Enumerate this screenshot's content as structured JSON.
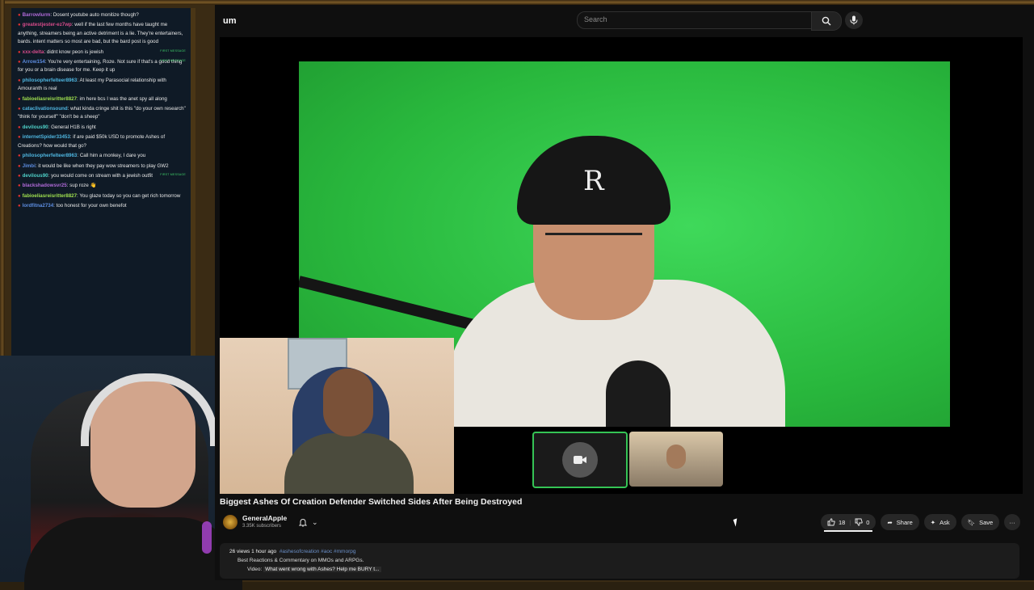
{
  "chat": [
    {
      "user": "Barrowlurm",
      "color": "#b06ad8",
      "text": "Dosent youtube auto monitize though?",
      "first": false
    },
    {
      "user": "greatestjester-ez7wp",
      "color": "#d64b8a",
      "text": "well if the last few months have taught me anything, streamers being an active detriment is a lie. They're entertainers, bards. intent matters so most are bad, but the bard post is good",
      "first": false
    },
    {
      "user": "xxx-delta",
      "color": "#d64b8a",
      "text": "didnt know peon is jewish",
      "first": true
    },
    {
      "user": "Arrow154",
      "color": "#5d8de0",
      "text": "You're very entertaining, Roze. Not sure if that's a good thing for you or a brain disease for me. Keep it up",
      "first": true
    },
    {
      "user": "philosopherfelteer8963",
      "color": "#4fb6e0",
      "text": "At least my Parasocial relationship with Amouranth is real",
      "first": false
    },
    {
      "user": "fabioeliasreisritter8827",
      "color": "#9fe04f",
      "text": "im here bcs I was the anet spy all along",
      "first": false
    },
    {
      "user": "cataclivationsound",
      "color": "#4fb6e0",
      "text": "what kinda cringe shit is this \"do your own research\" \"think for yourself\" \"don't be a sheep\"",
      "first": false
    },
    {
      "user": "devilous90",
      "color": "#4fd0c8",
      "text": "General H1B is right",
      "first": false
    },
    {
      "user": "internetSpider33453",
      "color": "#4fb6e0",
      "text": "if are paid $50k USD to promote Ashes of Creations? how would that go?",
      "first": false
    },
    {
      "user": "philosopherfelteer8963",
      "color": "#4fb6e0",
      "text": "Call him a monkey, I dare you",
      "first": false
    },
    {
      "user": "Jimbi",
      "color": "#5d8de0",
      "text": "it would be like when they pay wow streamers to play GW2",
      "first": false
    },
    {
      "user": "devilous90",
      "color": "#4fd0c8",
      "text": "you would come on stream with a jewish outfit",
      "first": true
    },
    {
      "user": "blackshadowsvr25",
      "color": "#b06ad8",
      "text": "sup roze 👋",
      "first": false
    },
    {
      "user": "fabioeliasreisritter8827",
      "color": "#9fe04f",
      "text": "You glaze today so you can get rich tomorrow",
      "first": false
    },
    {
      "user": "lordfitna2734",
      "color": "#5d8de0",
      "text": "too honest for your own benefot",
      "first": false
    }
  ],
  "first_badge": "FIRST MESSAGE",
  "youtube": {
    "logo": "um",
    "search_placeholder": "Search",
    "title": "Biggest Ashes Of Creation Defender Switched Sides After Being Destroyed",
    "channel": "GeneralApple",
    "subscribers": "3.35K subscribers",
    "likes": "18",
    "dislikes": "0",
    "share": "Share",
    "ask": "Ask",
    "save": "Save",
    "desc_views": "26 views  1 hour ago",
    "desc_tags": "#ashesofcreation #aoc #mmorpg",
    "desc_line2": "Best Reactions & Commentary on MMOs and ARPGs.",
    "desc_line3_prefix": "Video:",
    "desc_line3_link": "What went wrong with Ashes? Help me BURY t..."
  },
  "colors": {
    "green_screen": "#2fc548",
    "accent": "#35c455"
  }
}
